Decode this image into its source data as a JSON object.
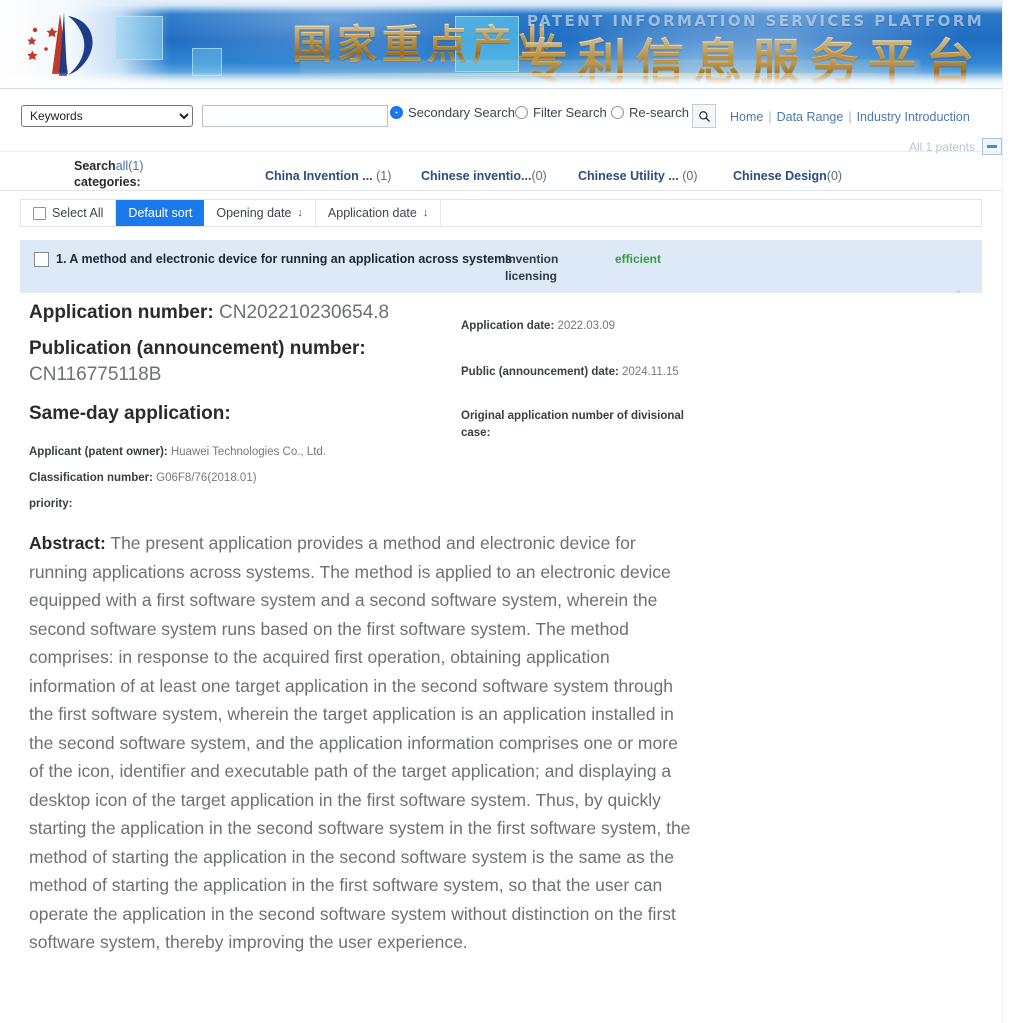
{
  "banner": {
    "cn_title_left": "国家重点产业",
    "cn_title_right": "专利信息服务平台",
    "en_title": "PATENT INFORMATION SERVICES PLATFORM",
    "logo_name": "patent-platform-logo"
  },
  "search": {
    "field_selected": "Keywords",
    "field_options": [
      "Keywords"
    ],
    "query_value": "",
    "query_placeholder": "",
    "modes": [
      {
        "label": "Secondary Search",
        "selected": true
      },
      {
        "label": "Filter Search",
        "selected": false
      },
      {
        "label": "Re-search",
        "selected": false
      }
    ],
    "search_button": "search-icon",
    "links": [
      "Home",
      "Data Range",
      "Industry Introduction"
    ],
    "separator": "|",
    "all_patents": "All 1 patents"
  },
  "categories": {
    "label_line1": "Search",
    "label_line2": "categories:",
    "label_count": "all(1)",
    "tabs": [
      {
        "label": "China Invention ...",
        "count": "(1)"
      },
      {
        "label": "Chinese inventio...",
        "count": "(0)"
      },
      {
        "label": "Chinese Utility ...",
        "count": "(0)"
      },
      {
        "label": "Chinese Design",
        "count": "(0)"
      }
    ]
  },
  "toolbar": {
    "select_all": "Select All",
    "default_sort": "Default sort",
    "opening_date": "Opening date",
    "application_date": "Application date",
    "sort_arrow": "↓"
  },
  "result": {
    "title": "1. A method and electronic device for running an application across systems",
    "tag": "Invention licensing",
    "status": "efficient",
    "status_color": "#3a9a46"
  },
  "detail": {
    "application_number_label": "Application number:",
    "application_number_value": "CN202210230654.8",
    "publication_number_label": "Publication (announcement) number:",
    "publication_number_value": "CN116775118B",
    "same_day_label": "Same-day application:",
    "same_day_value": "",
    "application_date_label": "Application date:",
    "application_date_value": "2022.03.09",
    "public_date_label": "Public (announcement) date:",
    "public_date_value": "2024.11.15",
    "divisional_label": "Original application number of divisional case:",
    "divisional_value": "",
    "applicant_label": "Applicant (patent owner):",
    "applicant_value": "Huawei Technologies Co., Ltd.",
    "classification_label": "Classification number:",
    "classification_value": "G06F8/76(2018.01)",
    "priority_label": "priority:",
    "priority_value": "",
    "abstract_label": "Abstract:",
    "abstract_text": "The present application provides a method and electronic device for running applications across systems. The method is applied to an electronic device equipped with a first software system and a second software system, wherein the second software system runs based on the first software system. The method comprises: in response to the acquired first operation, obtaining application information of at least one target application in the second software system through the first software system, wherein the target application is an application installed in the second software system, and the application information comprises one or more of the icon, identifier and executable path of the target application; and displaying a desktop icon of the target application in the first software system. Thus, by quickly starting the application in the second software system in the first software system, the method of starting the application in the second software system is the same as the method of starting the application in the first software system, so that the user can operate the application in the second software system without distinction on the first software system, thereby improving the user experience."
  },
  "colors": {
    "accent_blue": "#1a7aed",
    "banner_blue": "#1f6dc2",
    "row_highlight": "#dde9f6",
    "link_blue": "#4a7ab0",
    "gold": "#d9a848"
  }
}
